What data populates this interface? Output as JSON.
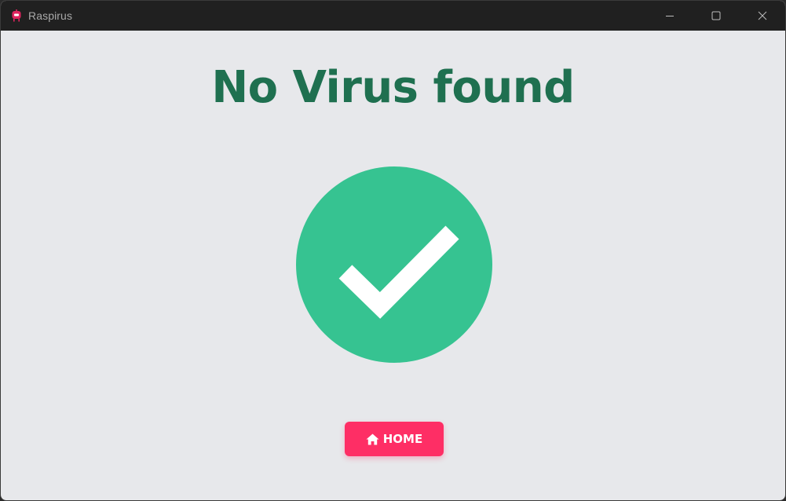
{
  "window": {
    "title": "Raspirus"
  },
  "result": {
    "heading": "No Virus found",
    "status_icon": "checkmark-icon"
  },
  "actions": {
    "home_label": "HOME",
    "home_icon": "house-icon"
  },
  "colors": {
    "titlebar": "#202020",
    "background": "#e7e8eb",
    "heading": "#1f7050",
    "success": "#36c391",
    "accent": "#fe2e65"
  }
}
